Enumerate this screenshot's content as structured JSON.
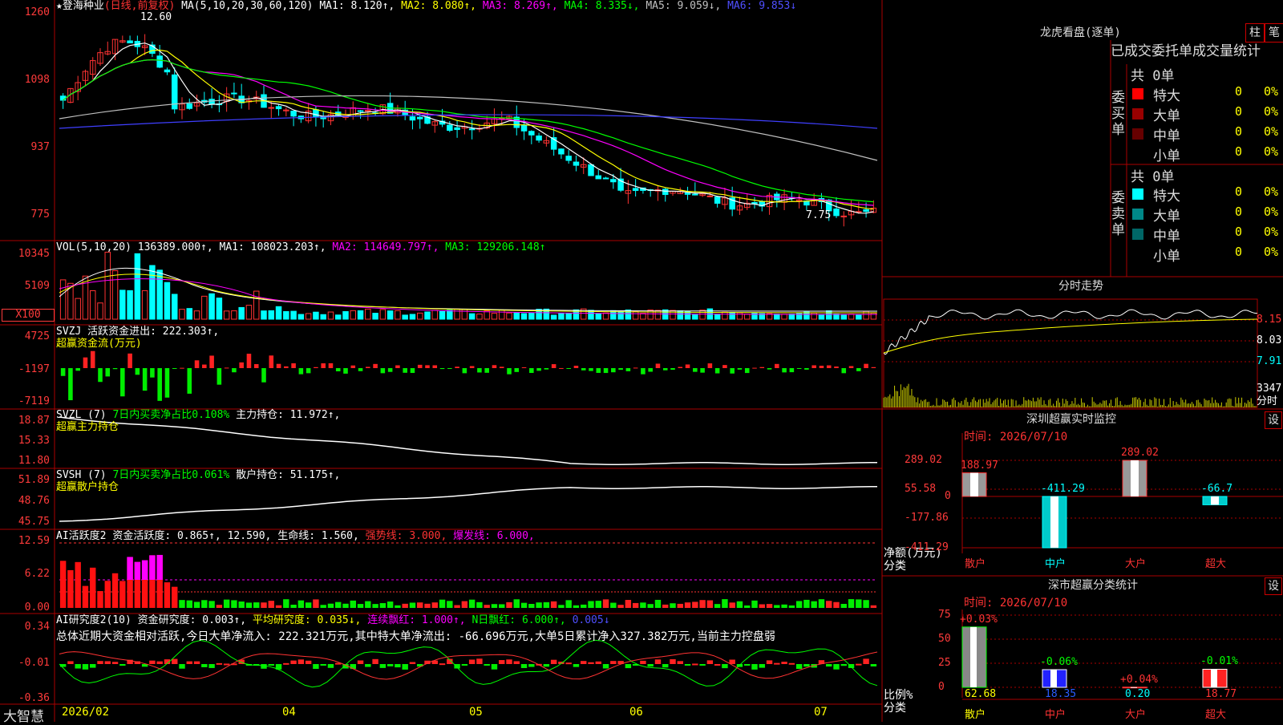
{
  "stock": {
    "name": "★登海种业",
    "mode": "(日线,前复权)",
    "ma_label": "MA(5,10,20,30,60,120)",
    "ma1": "MA1: 8.120↑,",
    "ma2": "MA2: 8.080↑,",
    "ma3": "MA3: 8.269↑,",
    "ma4": "MA4: 8.335↓,",
    "ma5": "MA5: 9.059↓,",
    "ma6": "MA6: 9.853↓",
    "high_note": "12.60",
    "low_note": "7.75",
    "y_labels": [
      "1260",
      "1098",
      "937",
      "775"
    ]
  },
  "vol": {
    "title": "VOL(5,10,20)",
    "value": "136389.000↑,",
    "ma1": "MA1: 108023.203↑,",
    "ma2": "MA2: 114649.797↑,",
    "ma3": "MA3: 129206.148↑",
    "y_labels": [
      "10345",
      "5109",
      "X100"
    ]
  },
  "svzj": {
    "title": "SVZJ",
    "v1": "活跃资金进出: 222.303↑,",
    "v2": "超赢资金流(万元)",
    "y_labels": [
      "4725",
      "-1197",
      "-7119"
    ]
  },
  "svzl": {
    "title": "SVZL (7)",
    "v1": "7日内买卖净占比0.108%",
    "v2": "主力持仓: 11.972↑,",
    "v3": "超赢主力持仓",
    "y_labels": [
      "18.87",
      "15.33",
      "11.80"
    ]
  },
  "svsh": {
    "title": "SVSH (7)",
    "v1": "7日内买卖净占比0.061%",
    "v2": "散户持仓: 51.175↑,",
    "v3": "超赢散户持仓",
    "y_labels": [
      "51.89",
      "48.76",
      "45.75"
    ]
  },
  "ai1": {
    "title": "AI活跃度2",
    "v1": "资金活跃度: 0.865↑,",
    "v2": "12.590,",
    "v3": "生命线: 1.560,",
    "v4": "强势线: 3.000,",
    "v5": "爆发线: 6.000,",
    "y_labels": [
      "12.59",
      "6.22",
      "0.00"
    ]
  },
  "ai2": {
    "title": "AI研究度2(10)",
    "v1": "资金研究度: 0.003↑,",
    "v2": "平均研究度: 0.035↓,",
    "v3": "连续飘红: 1.000↑,",
    "v4": "N日飘红: 6.000↑,",
    "v5": "0.005↓",
    "summary": "总体近期大资金相对活跃,今日大单净流入: 222.321万元,其中特大单净流出: -66.696万元,大单5日累计净入327.382万元,当前主力控盘弱",
    "y_labels": [
      "0.34",
      "-0.01",
      "-0.36"
    ]
  },
  "xaxis": {
    "brand": "大智慧",
    "labels": [
      "2026/02",
      "04",
      "05",
      "06",
      "07"
    ]
  },
  "right": {
    "lhkp_title": "龙虎看盘(逐单)",
    "btn_zhu": "柱",
    "btn_bi": "笔",
    "stat_title": "已成交委托单成交量统计",
    "buy_label": "委买单",
    "sell_label": "委卖单",
    "buy_total": "共 0单",
    "sell_total": "共 0单",
    "rows": [
      {
        "name": "特大",
        "val": "0",
        "pct": "0%"
      },
      {
        "name": "大单",
        "val": "0",
        "pct": "0%"
      },
      {
        "name": "中单",
        "val": "0",
        "pct": "0%"
      },
      {
        "name": "小单",
        "val": "0",
        "pct": "0%"
      }
    ],
    "buy_colors": [
      "#ff0000",
      "#990000",
      "#660000"
    ],
    "sell_colors": [
      "#00ffff",
      "#008888",
      "#006666"
    ],
    "fenshi_title": "分时走势",
    "fenshi_prices": [
      "8.15",
      "8.03",
      "7.91"
    ],
    "fenshi_vol": "3347",
    "fenshi_vol_unit": "分时",
    "sz_title": "深圳超赢实时监控",
    "sz_btn": "设",
    "sz_time": "时间: 2026/07/10",
    "sz_y": [
      "289.02",
      "55.58",
      "0",
      "-177.86",
      "-411.29"
    ],
    "sz_unit1": "净额(万元)",
    "sz_unit2": "分类",
    "sz_bars": [
      {
        "name": "散户",
        "value": 188.97,
        "label": "188.97"
      },
      {
        "name": "中户",
        "value": -411.29,
        "label": "-411.29"
      },
      {
        "name": "大户",
        "value": 289.02,
        "label": "289.02"
      },
      {
        "name": "超大",
        "value": -66.7,
        "label": "-66.7"
      }
    ],
    "ss_title": "深市超赢分类统计",
    "ss_btn": "设",
    "ss_time": "时间: 2026/07/10",
    "ss_y": [
      "75",
      "50",
      "25",
      "0"
    ],
    "ss_unit1": "比例%",
    "ss_unit2": "分类",
    "ss_bars": [
      {
        "name": "散户",
        "value": 62.68,
        "label": "62.68",
        "delta": "+0.03%"
      },
      {
        "name": "中户",
        "value": 18.35,
        "label": "18.35",
        "delta": "-0.06%"
      },
      {
        "name": "大户",
        "value": 0.2,
        "label": "0.20",
        "delta": "+0.04%"
      },
      {
        "name": "超大",
        "value": 18.77,
        "label": "18.77",
        "delta": "-0.01%"
      }
    ]
  },
  "colors": {
    "up": "#ff3333",
    "down": "#00ffff",
    "grid": "#aa0000",
    "ma1": "#ffffff",
    "ma2": "#ffff00",
    "ma3": "#ff00ff",
    "ma4": "#00ff00",
    "ma5": "#c0c0c0",
    "ma6": "#3f3fff"
  }
}
